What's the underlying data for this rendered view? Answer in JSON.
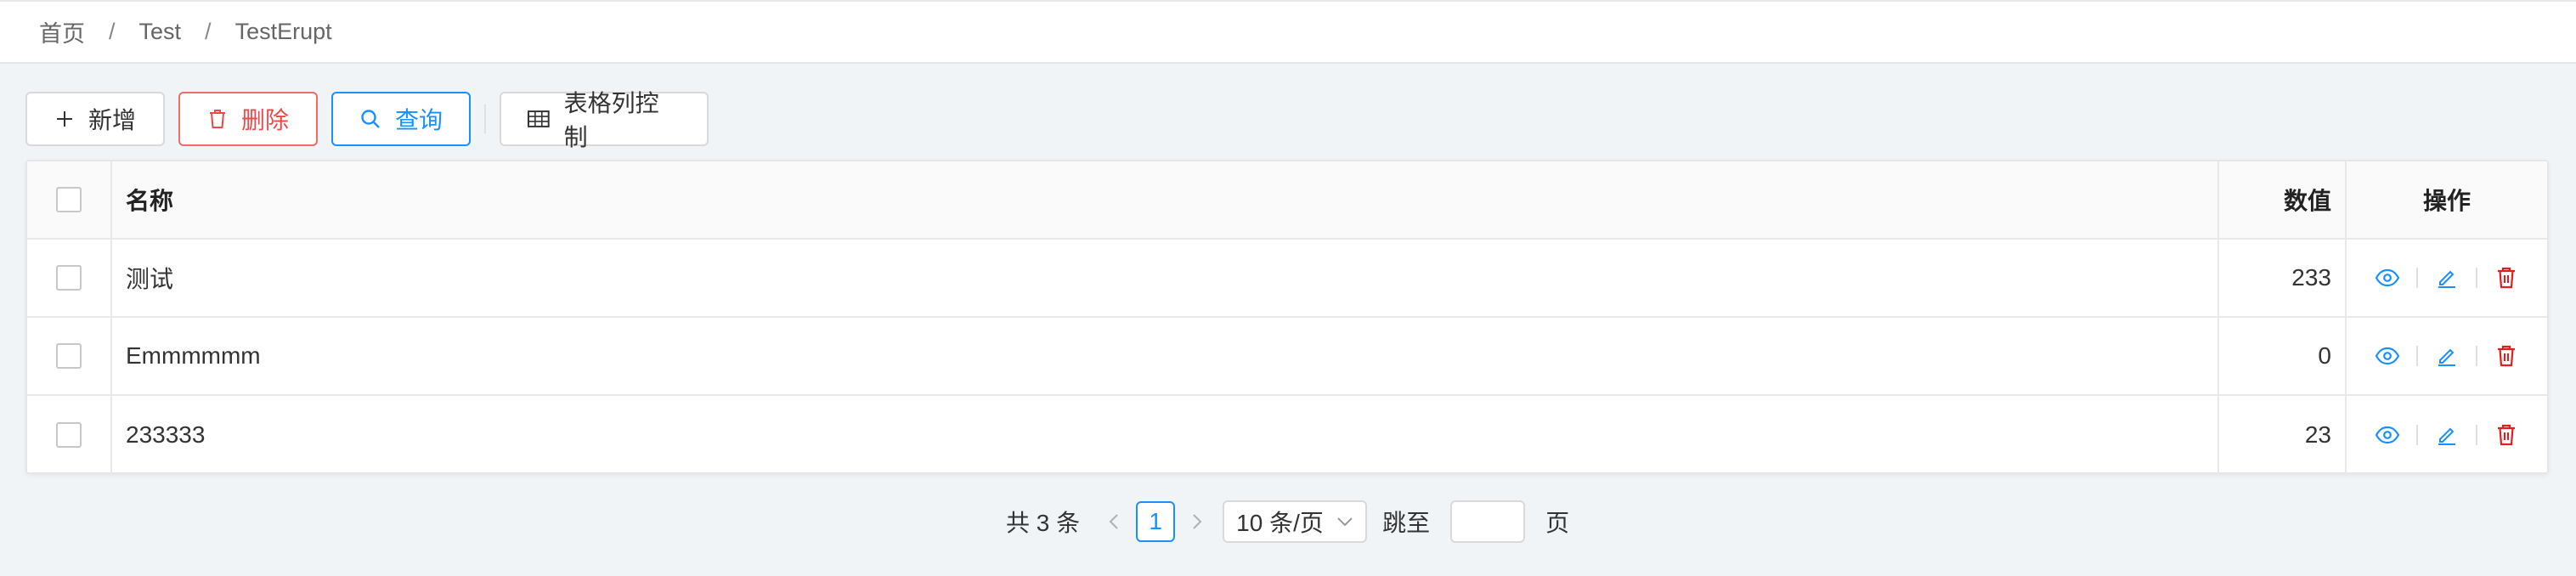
{
  "breadcrumb": {
    "items": [
      "首页",
      "Test",
      "TestErupt"
    ],
    "separator": "/"
  },
  "toolbar": {
    "add_label": "新增",
    "delete_label": "删除",
    "query_label": "查询",
    "columns_label": "表格列控制"
  },
  "table": {
    "headers": {
      "name": "名称",
      "value": "数值",
      "ops": "操作"
    },
    "rows": [
      {
        "name": "测试",
        "value": "233"
      },
      {
        "name": "Emmmmmm",
        "value": "0"
      },
      {
        "name": "233333",
        "value": "23"
      }
    ],
    "row_actions": [
      "eye-icon",
      "edit-icon",
      "delete-icon"
    ]
  },
  "pagination": {
    "total_text": "共 3 条",
    "current_page": "1",
    "page_size": "10 条/页",
    "jump_label": "跳至",
    "page_suffix": "页"
  },
  "colors": {
    "primary": "#1890ff",
    "danger": "#f04848",
    "background": "#f1f4f7"
  }
}
